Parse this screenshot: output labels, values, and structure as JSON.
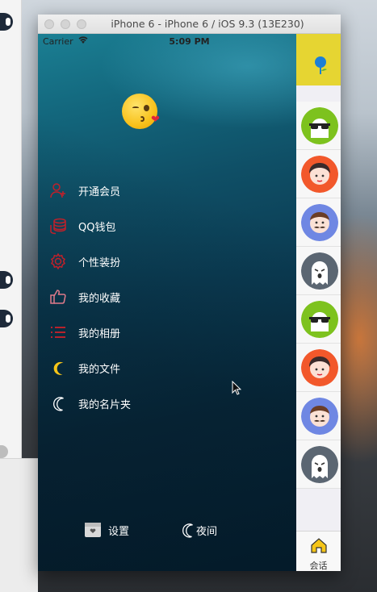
{
  "window": {
    "title": "iPhone 6 - iPhone 6 / iOS 9.3 (13E230)"
  },
  "status_bar": {
    "carrier": "Carrier",
    "time": "5:09 PM"
  },
  "drawer": {
    "avatar_icon": "kissing-face-emoji",
    "menu": [
      {
        "label": "开通会员",
        "icon": "add-user-icon",
        "icon_color": "#c0202a"
      },
      {
        "label": "QQ钱包",
        "icon": "coins-icon",
        "icon_color": "#c0202a"
      },
      {
        "label": "个性装扮",
        "icon": "gear-icon",
        "icon_color": "#c0202a"
      },
      {
        "label": "我的收藏",
        "icon": "thumbs-up-icon",
        "icon_color": "#e07a8a"
      },
      {
        "label": "我的相册",
        "icon": "list-icon",
        "icon_color": "#d0202a"
      },
      {
        "label": "我的文件",
        "icon": "moon-icon",
        "icon_color": "#f5c518"
      },
      {
        "label": "我的名片夹",
        "icon": "moon-outline-icon",
        "icon_color": "#ffffff"
      }
    ],
    "footer": {
      "settings_label": "设置",
      "night_label": "夜间"
    }
  },
  "right_panel": {
    "contacts": [
      {
        "avatar": "sunglasses-avatar",
        "color": "#7dc21e"
      },
      {
        "avatar": "girl-avatar",
        "color": "#f2582b"
      },
      {
        "avatar": "mustache-avatar",
        "color": "#6f87e3"
      },
      {
        "avatar": "ghost-avatar",
        "color": "#5b6672"
      },
      {
        "avatar": "sunglasses-avatar",
        "color": "#7dc21e"
      },
      {
        "avatar": "girl-avatar",
        "color": "#f2582b"
      },
      {
        "avatar": "mustache-avatar",
        "color": "#6f87e3"
      },
      {
        "avatar": "ghost-avatar",
        "color": "#5b6672"
      }
    ],
    "tab_label": "会话"
  },
  "colors": {
    "header_yellow": "#e6d532",
    "drawer_top": "#1b7f93",
    "drawer_bottom": "#062233"
  }
}
